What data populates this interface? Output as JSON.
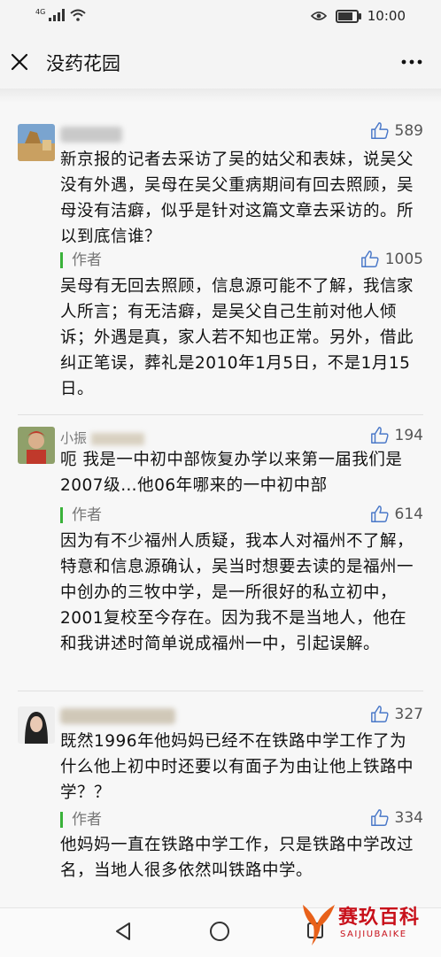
{
  "status_bar": {
    "network": "4G",
    "time": "10:00"
  },
  "header": {
    "title": "没药花园"
  },
  "comments": [
    {
      "likes": "589",
      "text": "新京报的记者去采访了吴的姑父和表妹，说吴父没有外遇，吴母在吴父重病期间有回去照顾，吴母没有洁癖，似乎是针对这篇文章去采访的。所以到底信谁？",
      "reply": {
        "author_label": "作者",
        "likes": "1005",
        "text": "吴母有无回去照顾，信息源可能不了解，我信家人所言；有无洁癖，是吴父自己生前对他人倾诉；外遇是真，家人若不知也正常。另外，借此纠正笔误，葬礼是2010年1月5日，不是1月15日。"
      }
    },
    {
      "name_partial": "小振",
      "likes": "194",
      "text": "呃 我是一中初中部恢复办学以来第一届我们是2007级…他06年哪来的一中初中部",
      "reply": {
        "author_label": "作者",
        "likes": "614",
        "text": "因为有不少福州人质疑，我本人对福州不了解，特意和信息源确认，吴当时想要去读的是福州一中创办的三牧中学，是一所很好的私立初中，2001复校至今存在。因为我不是当地人，他在和我讲述时简单说成福州一中，引起误解。"
      }
    },
    {
      "likes": "327",
      "text": "既然1996年他妈妈已经不在铁路中学工作了为什么他上初中时还要以有面子为由让他上铁路中学？？",
      "reply": {
        "author_label": "作者",
        "likes": "334",
        "text": "他妈妈一直在铁路中学工作，只是铁路中学改过名，当地人很多依然叫铁路中学。"
      }
    }
  ],
  "watermark": {
    "name": "赛玖百科",
    "sub": "SAIJIUBAIKE"
  }
}
